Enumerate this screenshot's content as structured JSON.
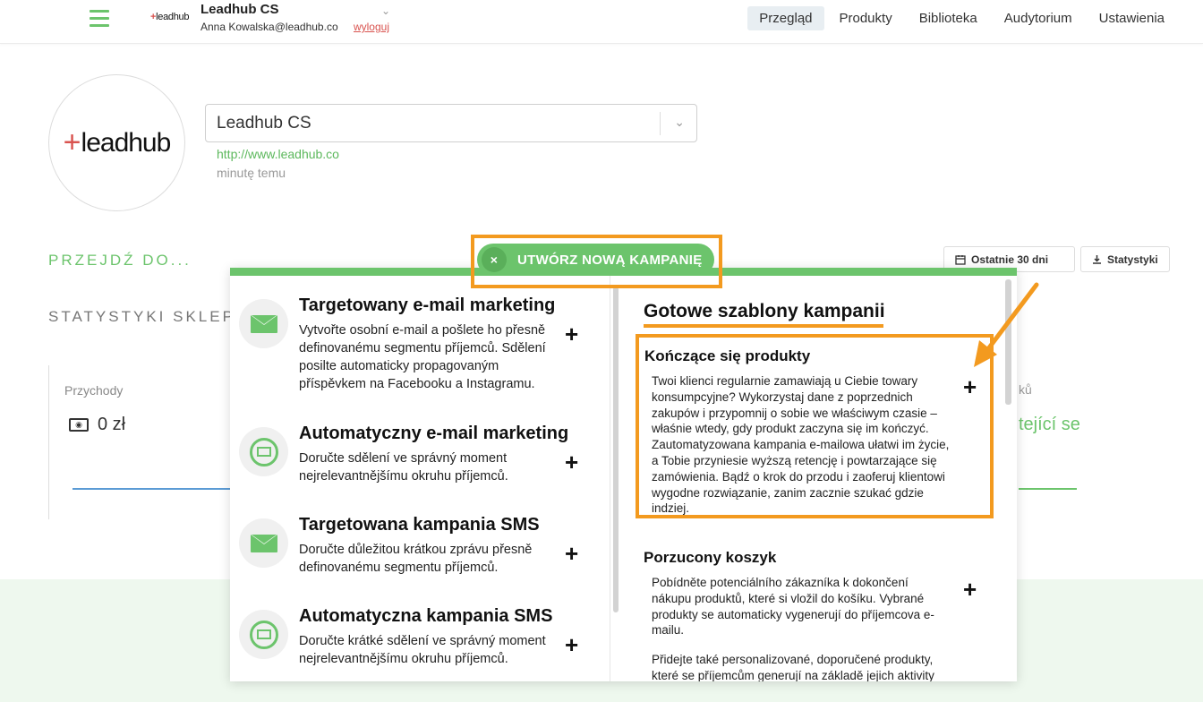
{
  "header": {
    "mini_logo": "leadhub",
    "account_name": "Leadhub CS",
    "user_email": "Anna Kowalska@leadhub.co",
    "logout_label": "wyloguj",
    "nav": [
      "Przegląd",
      "Produkty",
      "Biblioteka",
      "Audytorium",
      "Ustawienia"
    ],
    "active_nav": "Przegląd"
  },
  "profile": {
    "logo_text": "leadhub",
    "store_name": "Leadhub CS",
    "store_url": "http://www.leadhub.co",
    "updated": "minutę temu"
  },
  "page": {
    "goto_label": "PRZEJDŹ DO...",
    "stats_title": "STATYSTYKI SKLEPU",
    "range_button": "Ostatnie 30 dni",
    "stats_button": "Statystyki",
    "revenue_label": "Przychody",
    "revenue_value": "0 zł",
    "right_label": "ků",
    "right_value": "tející se",
    "colors": {
      "accent": "#6cc46c",
      "highlight": "#f39a1f"
    }
  },
  "modal": {
    "create_button": "UTWÓRZ NOWĄ KAMPANIĘ",
    "close_icon": "×",
    "campaigns": [
      {
        "title": "Targetowany e-mail marketing",
        "desc": "Vytvořte osobní e-mail a pošlete ho přesně definovanému segmentu příjemců. Sdělení posilte automaticky propagovaným příspěvkem na Facebooku a Instagramu.",
        "icon": "envelope-icon"
      },
      {
        "title": "Automatyczny e-mail marketing",
        "desc": "Doručte sdělení ve správný moment nejrelevantnějšímu okruhu příjemců.",
        "icon": "auto-email-icon"
      },
      {
        "title": "Targetowana kampania SMS",
        "desc": "Doručte důležitou krátkou zprávu přesně definovanému segmentu příjemců.",
        "icon": "envelope-icon"
      },
      {
        "title": "Automatyczna kampania SMS",
        "desc": "Doručte krátké sdělení ve správný moment nejrelevantnějšímu okruhu příjemců.",
        "icon": "auto-sms-icon"
      }
    ],
    "templates_title": "Gotowe szablony kampanii",
    "templates": [
      {
        "title": "Kończące się produkty",
        "desc": "Twoi klienci regularnie zamawiają u Ciebie towary konsumpcyjne? Wykorzystaj dane z poprzednich zakupów i przypomnij o sobie we właściwym czasie – właśnie wtedy, gdy produkt zaczyna się im kończyć. Zautomatyzowana kampania e-mailowa ułatwi im życie, a Tobie przyniesie wyższą retencję i powtarzające się zamówienia. Bądź o krok do przodu i zaoferuj klientowi wygodne rozwiązanie, zanim zacznie szukać gdzie indziej."
      },
      {
        "title": "Porzucony koszyk",
        "desc": "Pobídněte potenciálního zákazníka k dokončení nákupu produktů, které si vložil do košíku. Vybrané produkty se automaticky vygenerují do příjemcova e-mailu.",
        "desc2": "Přidejte také personalizované, doporučené produkty, které se příjemcům generují na základě jejich aktivity"
      }
    ]
  }
}
